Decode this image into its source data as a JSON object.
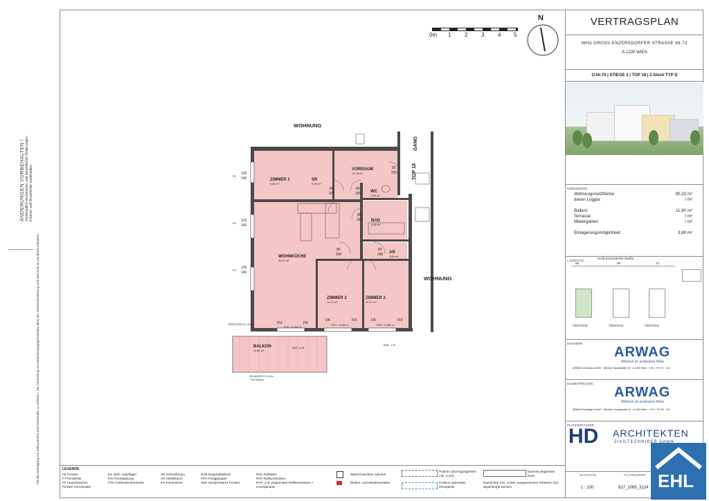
{
  "side": {
    "heading": "ÄNDERUNGEN VORBEHALTEN !",
    "line1": "Vorbehaltlich technischer und behördlicher Änderungen,",
    "line2": "Irrtümer und Druckfehler vorbehalten.",
    "bottom": "Für die Anfertigung von Einbaumöbel sind Naturmaße zu nehmen ! Die Darstellung von Einrichtungsgegenständen dient der Veranschaulichung und sind nicht im Kaufpreis enthalten."
  },
  "scale": {
    "labels": [
      "0m",
      "1",
      "2",
      "3",
      "4",
      "5"
    ]
  },
  "north": "N",
  "panel": {
    "title": "VERTRAGSPLAN",
    "address": "WHA GROSS-ENZERSDORFER STRASSE 66-72",
    "city": "A-1220 WIEN",
    "code": "O.Nr.70 | STIEGE 3 |    TOP 18  |  2.Stock   TYP D",
    "kennwerte_h": "KENNWERTE:",
    "nutzflaeche_l": "Wohnungsnutzfläche:",
    "nutzflaeche_v": "90,23 m²",
    "loggia_l": "davon Loggia:",
    "loggia_v": "/ m²",
    "balkon_l": "Balkon:",
    "balkon_v": "11,90 m²",
    "terrasse_l": "Terrasse:",
    "terrasse_v": "/ m²",
    "mietergarten_l": "Mietergarten:",
    "mietergarten_v": "/ m²",
    "einlagerung_l": "Einlagerungsmöglichkeit",
    "einlagerung_v": "3,89 m²",
    "lageplan_h": "LAGEPLAN:",
    "lageplan_street": "Groß-Enzersdorfer Straße",
    "lageplan_nums": [
      "66",
      "68",
      "72"
    ],
    "lageplan_tags": [
      "70/STGH3",
      "70/STGH2",
      "70/STGH1"
    ],
    "bauherr_h": "BAUHERR:",
    "bautreuung_h": "BAUBETREUUNG:",
    "arwag": "ARWAG",
    "arwag_sub": "Wohnen im schönsten Wien",
    "bauherr_txt": "ARWAG Wohnbau GmbH · Wiedner Hauptstraße 15 · A-1040 Wien · +43 1 797 00 · 421",
    "bautreuung_txt": "ARWAG Bauträger GmbH · Wiedner Hauptstraße 15 · A-1040 Wien · +43 1 797 00 · 421",
    "planverfasser_h": "PLANVERFASSER:",
    "hd": "HD",
    "hd_name": "ARCHITEKTEN",
    "hd_sub": "ZIVILTECHNIKER GmbH",
    "massstab_h": "MASSSTAB",
    "massstab_v": "1 : 100",
    "plannr_h": "PLANNUMMER",
    "plannr_v": "817_1065_3124",
    "ehl": "EHL"
  },
  "plan": {
    "wohnung_top": "WOHNUNG",
    "wohnung_right": "WOHNUNG",
    "gang": "GANG",
    "top18": "TOP 18",
    "rooms": [
      {
        "name": "ZIMMER 1",
        "area": "9,80 m²"
      },
      {
        "name": "VORRAUM",
        "area": "12,18 m²"
      },
      {
        "name": "WC",
        "area": "1,86 m²"
      },
      {
        "name": "BAD",
        "area": "6,66 m²"
      },
      {
        "name": "AR",
        "area": "3,09 m²"
      },
      {
        "name": "WOHNKÜCHE",
        "area": "33,11 m²"
      },
      {
        "name": "ZIMMER 2",
        "area": "10,72 m²"
      },
      {
        "name": "ZIMMER 3",
        "area": "10,71 m²"
      },
      {
        "name": "BALKON",
        "area": "11,90 m²"
      }
    ],
    "sr": "SR",
    "sr_area": "0,96 m²",
    "door_dims": [
      "80",
      "200",
      "80",
      "200",
      "80",
      "200",
      "80",
      "200",
      "80",
      "200",
      "80",
      "200",
      "90",
      "200",
      "80",
      "200"
    ],
    "fix": "FIX",
    "dk": "DK",
    "fph": "FPH: +0,86 m",
    "window_dims": [
      "125",
      "140"
    ],
    "fe": "FE",
    "raf": "RAF_1+E",
    "bruestung": "BRÜSTUNG H=1,02m",
    "gelaender": "GELÄNDER H=1,02m",
    "fok": "FOK Balkon"
  },
  "legend": {
    "title": "LEGENDE:",
    "c1": [
      "FE  Fenster",
      "FT  Fenstertür",
      "FF  Französisches",
      "      Fenster mit Kämpfer"
    ],
    "c2": [
      "DK  Dreh- Kippflügel",
      "FIX  Fixverglasung",
      "FOK  Fußbodenoberkante"
    ],
    "c3": [
      "SR  Schrankraum",
      "AR  Abstellraum",
      "KN  Kochnische"
    ],
    "c4": [
      "RAR  Regenabfallrohr",
      "FPH  Fertigparapet",
      "VER  Versperrbares Fenster"
    ],
    "c5": [
      "ROL  Rollladen",
      "RAF  Raffstorekasten",
      "RAF_1+E vorgerichtet Raffstorekästen +",
      "           Innenjalousie"
    ],
    "wm": "Waschmaschine optional",
    "ev": "Elektro- und Medienverteiler",
    "potteri": "Potterie (Durchgangshöhe min. 2,1m)",
    "klima": "Position optionales Klimagerät",
    "extensiv": "Extensiv begrüntes Dach",
    "raum": "Raumhöhe min. 2,50m, ausgenommen Potterien und abgehängte Decken"
  }
}
